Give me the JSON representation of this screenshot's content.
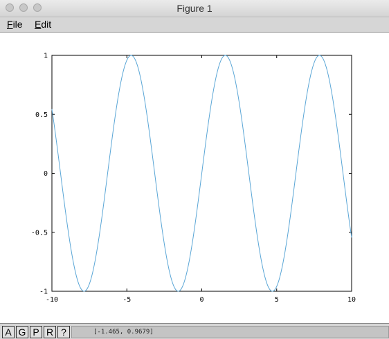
{
  "window": {
    "title": "Figure 1"
  },
  "menubar": {
    "file": {
      "mnemonic": "F",
      "rest": "ile"
    },
    "edit": {
      "mnemonic": "E",
      "rest": "dit"
    }
  },
  "toolbar": {
    "buttons": [
      "A",
      "G",
      "P",
      "R",
      "?"
    ]
  },
  "status": {
    "coordinates": "[-1.465, 0.9679]"
  },
  "colors": {
    "line": "#5aa6d6"
  },
  "chart_data": {
    "type": "line",
    "title": "",
    "xlabel": "",
    "ylabel": "",
    "xlim": [
      -10,
      10
    ],
    "ylim": [
      -1,
      1
    ],
    "xticks": [
      -10,
      -5,
      0,
      5,
      10
    ],
    "xtick_labels": [
      "-10",
      "-5",
      "0",
      "5",
      "10"
    ],
    "yticks": [
      1,
      0.5,
      0,
      -0.5,
      -1
    ],
    "ytick_labels": [
      "1",
      "0.5",
      "0",
      "-0.5",
      "-1"
    ],
    "grid": false,
    "legend": "none",
    "series": [
      {
        "function": "y = sin(x)",
        "x": [
          -10,
          -9.5,
          -9,
          -8.5,
          -8,
          -7.5,
          -7,
          -6.5,
          -6,
          -5.5,
          -5,
          -4.5,
          -4,
          -3.5,
          -3,
          -2.5,
          -2,
          -1.5,
          -1,
          -0.5,
          0,
          0.5,
          1,
          1.5,
          2,
          2.5,
          3,
          3.5,
          4,
          4.5,
          5,
          5.5,
          6,
          6.5,
          7,
          7.5,
          8,
          8.5,
          9,
          9.5,
          10
        ],
        "y": [
          0.544,
          0.075,
          -0.412,
          -0.798,
          -0.989,
          -0.938,
          -0.657,
          -0.215,
          0.279,
          0.706,
          0.959,
          0.978,
          0.757,
          0.351,
          -0.141,
          -0.598,
          -0.909,
          -0.997,
          -0.841,
          -0.479,
          0,
          0.479,
          0.841,
          0.997,
          0.909,
          0.598,
          0.141,
          -0.351,
          -0.757,
          -0.978,
          -0.959,
          -0.706,
          -0.279,
          0.215,
          0.657,
          0.938,
          0.989,
          0.798,
          0.412,
          -0.075,
          -0.544
        ]
      }
    ]
  }
}
